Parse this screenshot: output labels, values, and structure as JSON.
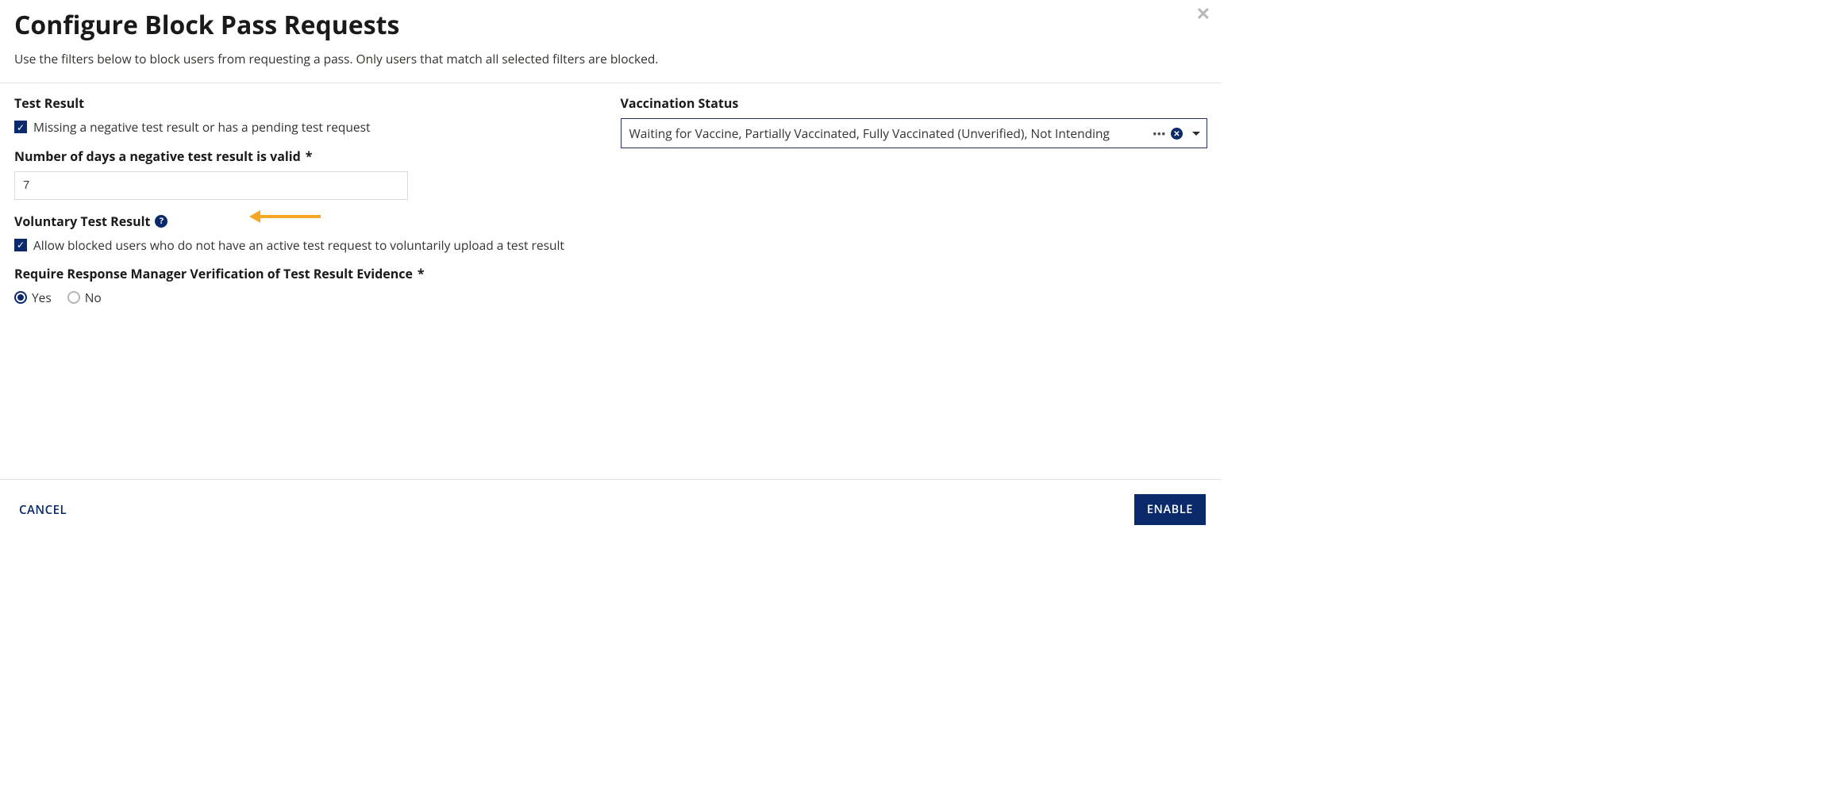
{
  "header": {
    "title": "Configure Block Pass Requests",
    "subtitle": "Use the filters below to block users from requesting a pass. Only users that match all selected filters are blocked."
  },
  "left": {
    "test_result_label": "Test Result",
    "test_result_checkbox_label": "Missing a negative test result or has a pending test request",
    "days_label": "Number of days a negative test result is valid",
    "days_required_marker": "*",
    "days_value": "7",
    "voluntary_label": "Voluntary Test Result",
    "voluntary_checkbox_label": "Allow blocked users who do not have an active test request to voluntarily upload a test result",
    "require_verify_label": "Require Response Manager Verification of Test Result Evidence",
    "require_verify_required_marker": "*",
    "radio_yes": "Yes",
    "radio_no": "No"
  },
  "right": {
    "vacc_status_label": "Vaccination Status",
    "vacc_status_value": "Waiting for Vaccine, Partially Vaccinated, Fully Vaccinated (Unverified), Not Intending"
  },
  "footer": {
    "cancel_label": "CANCEL",
    "enable_label": "ENABLE"
  }
}
